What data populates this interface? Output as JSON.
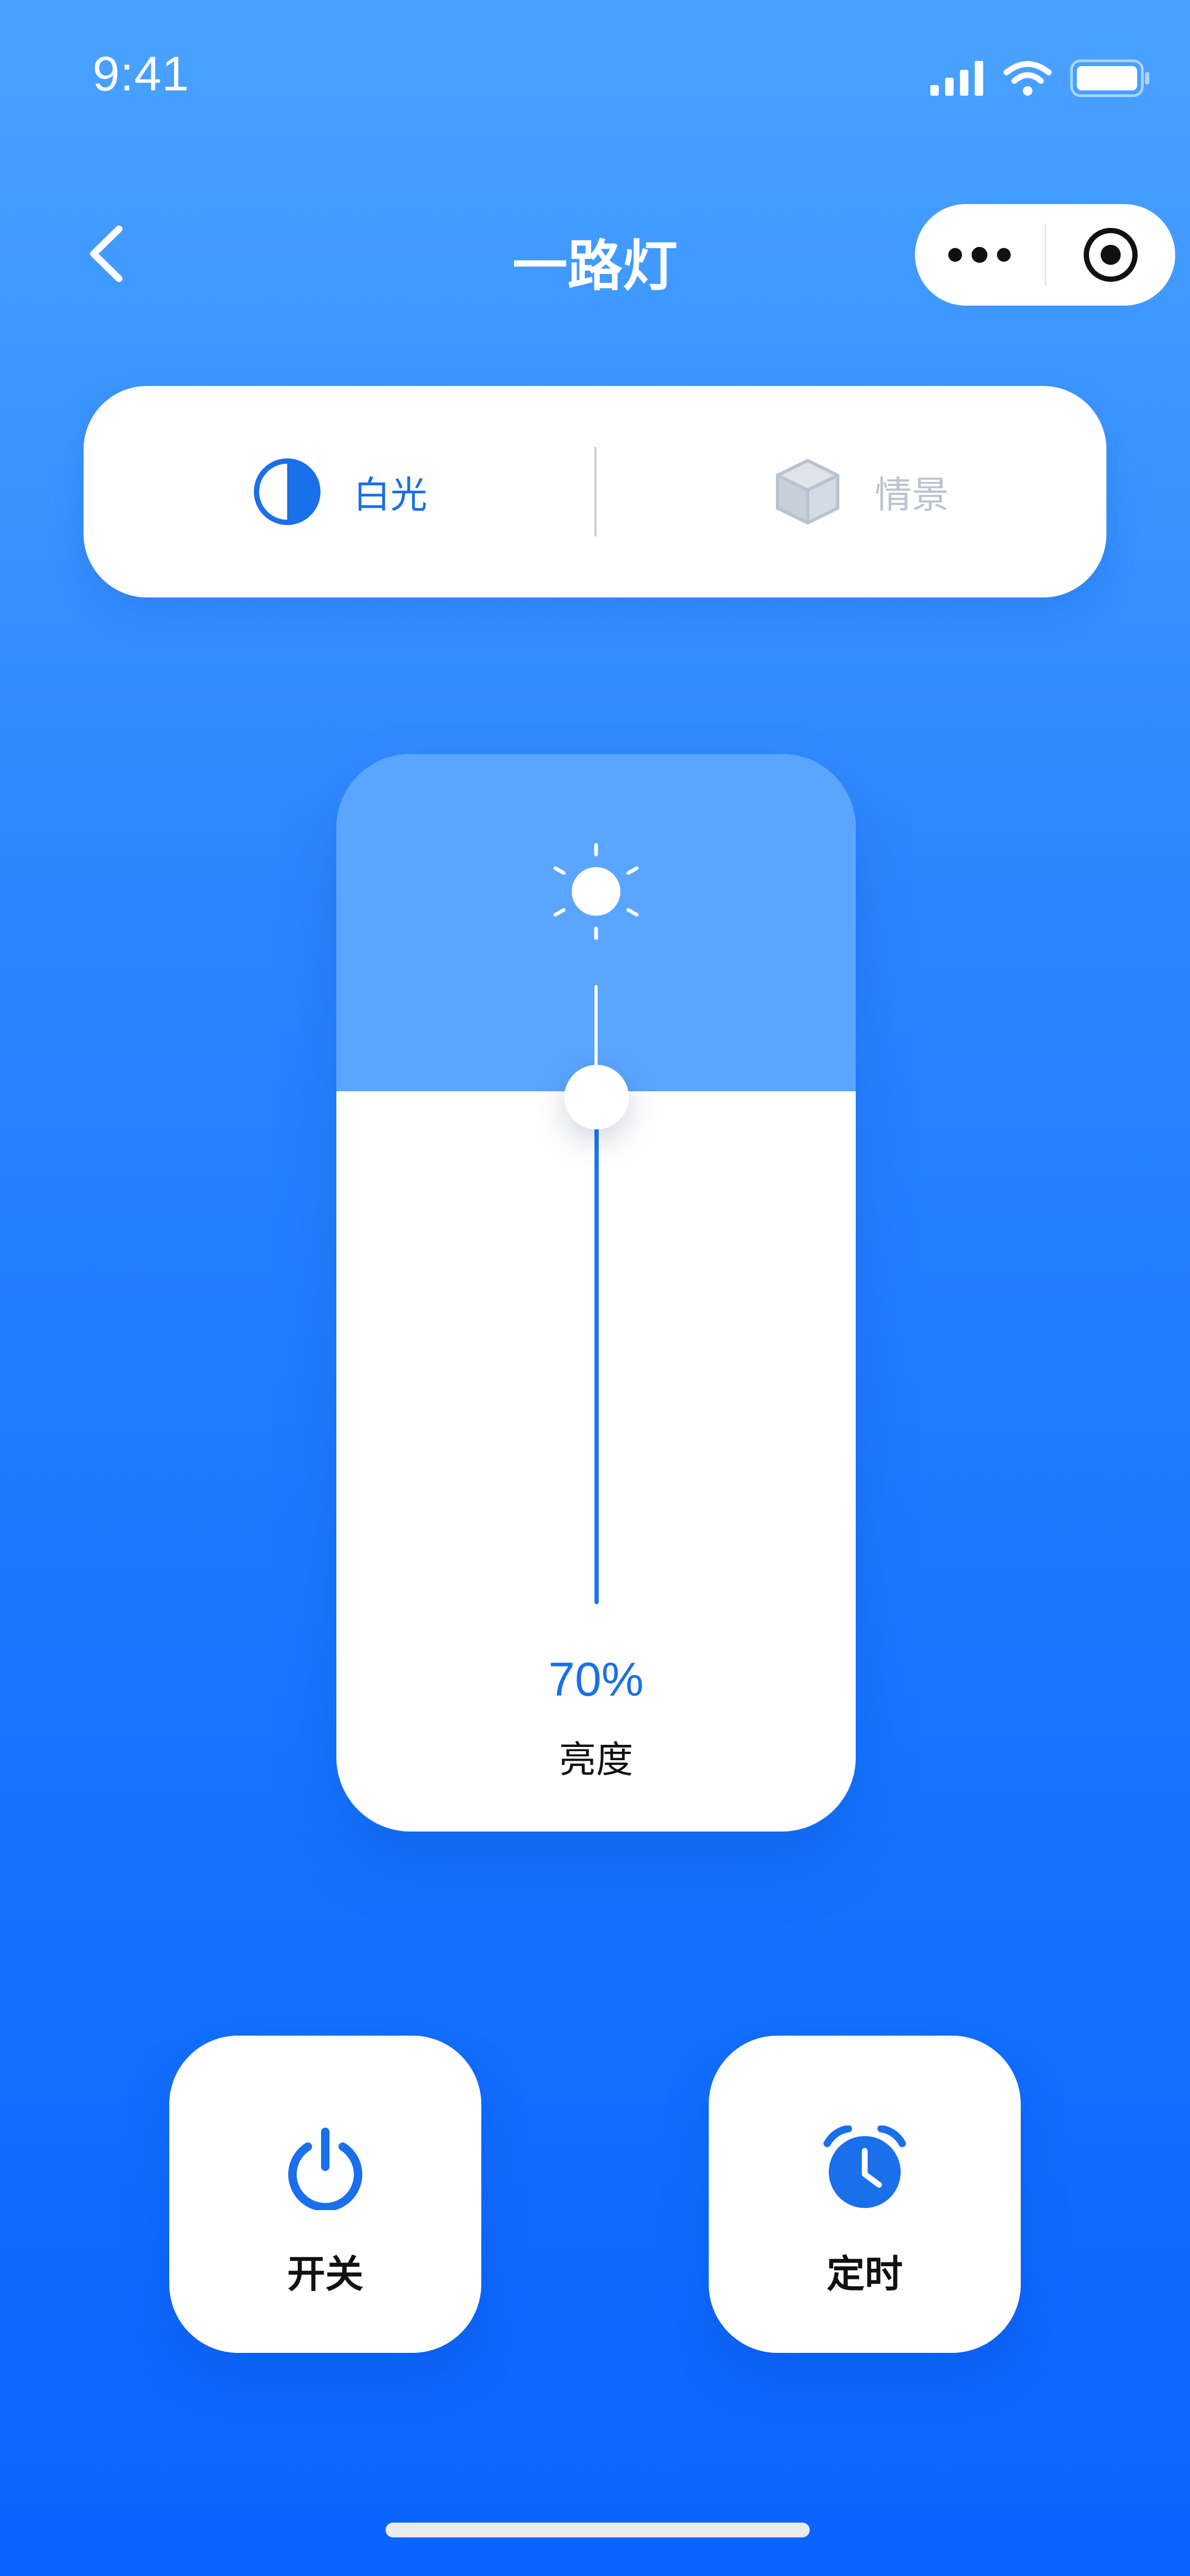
{
  "status_bar": {
    "time": "9:41",
    "signal_icon": "cellular-signal-icon",
    "wifi_icon": "wifi-icon",
    "battery_icon": "battery-icon"
  },
  "header": {
    "title": "一路灯",
    "back_icon": "chevron-left-icon",
    "more_icon": "more-dots-icon",
    "close_icon": "target-circle-icon"
  },
  "mode_tabs": [
    {
      "label": "白光",
      "icon": "half-circle-icon",
      "active": true
    },
    {
      "label": "情景",
      "icon": "cube-icon",
      "active": false
    }
  ],
  "brightness": {
    "value": 0.7,
    "value_text": "70%",
    "label": "亮度",
    "icon": "sun-icon"
  },
  "actions": [
    {
      "label": "开关",
      "icon": "power-icon"
    },
    {
      "label": "定时",
      "icon": "alarm-clock-icon"
    }
  ],
  "colors": {
    "accent": "#1a6fea",
    "inactive": "#b9c2cf",
    "background_top": "#4aa2ff",
    "background_bottom": "#0a63ff"
  }
}
